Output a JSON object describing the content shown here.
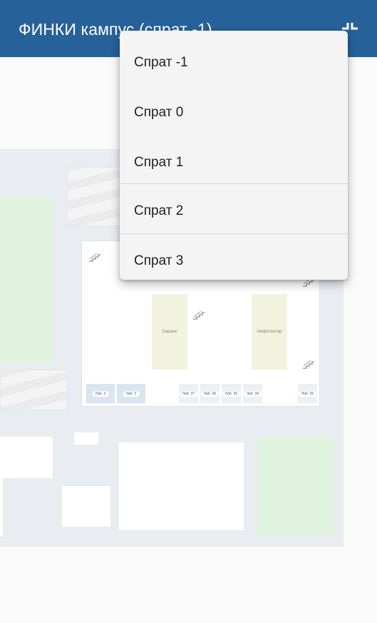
{
  "app_bar": {
    "title": "ФИНКИ кампус (спрат -1)",
    "action_icon": "fullscreen-exit-icon",
    "background_color": "#26619a"
  },
  "map": {
    "halls": [
      {
        "label": "Барака"
      },
      {
        "label": "Амфитеатар"
      }
    ],
    "rooms": [
      {
        "label": "Лаб. 3"
      },
      {
        "label": "Лаб. 2"
      },
      {
        "label": "Лаб. 37"
      },
      {
        "label": "Лаб. 36"
      },
      {
        "label": "Лаб. 35"
      },
      {
        "label": "Лаб. 34"
      },
      {
        "label": "Лаб. 25"
      }
    ],
    "stairs_icon": "stairs-icon"
  },
  "floor_menu": {
    "items": [
      {
        "label": "Спрат -1"
      },
      {
        "label": "Спрат 0"
      },
      {
        "label": "Спрат 1"
      },
      {
        "label": "Спрат 2"
      },
      {
        "label": "Спрат 3"
      }
    ]
  }
}
